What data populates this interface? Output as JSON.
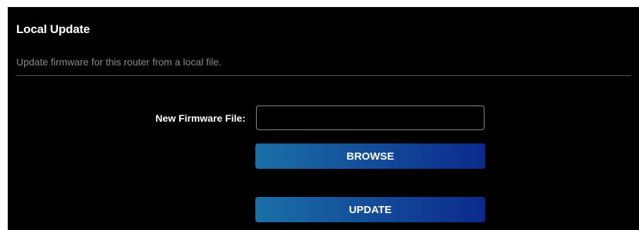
{
  "panel": {
    "title": "Local Update",
    "subtitle": "Update firmware for this router from a local file."
  },
  "form": {
    "file_label": "New Firmware File:",
    "file_value": "",
    "browse_label": "BROWSE",
    "update_label": "UPDATE"
  },
  "colors": {
    "panel_background": "#000000",
    "button_gradient_start": "#1b6fa6",
    "button_gradient_end": "#0b2a8c",
    "subtitle_text": "#8a8a8a",
    "input_border": "#8a8a8a"
  }
}
